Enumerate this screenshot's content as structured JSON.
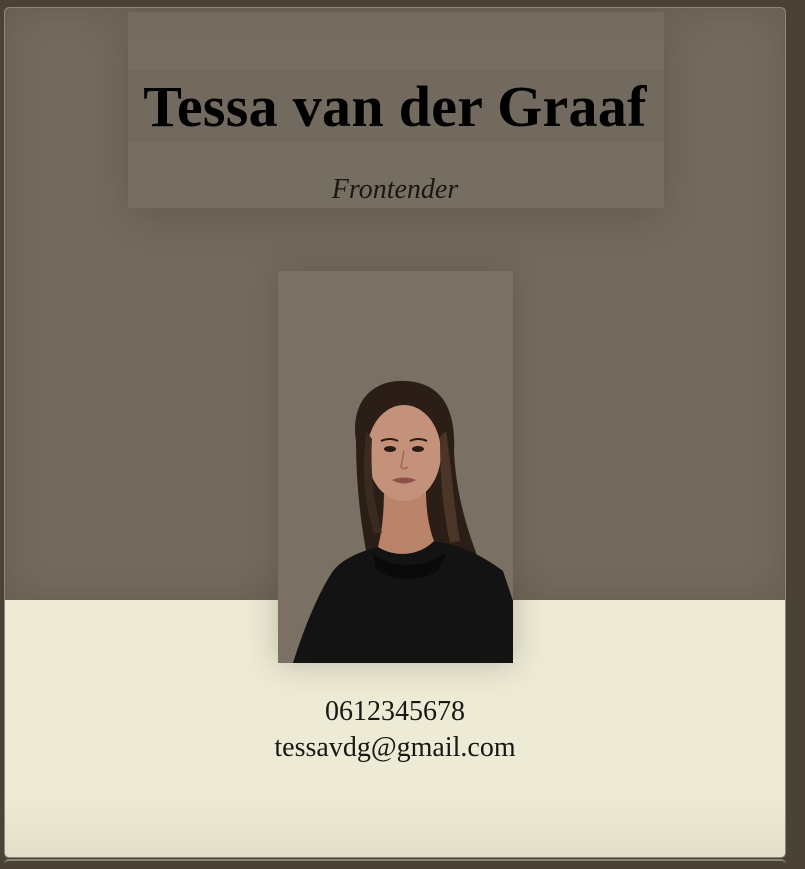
{
  "profile": {
    "name": "Tessa van der Graaf",
    "role": "Frontender",
    "phone": "0612345678",
    "email": "tessavdg@gmail.com"
  },
  "colors": {
    "page_background": "#4a4237",
    "top_panel": "#746a5e",
    "bottom_panel": "#edebd5",
    "heading_text": "#000000"
  },
  "icons": {
    "portrait": "profile-photo"
  }
}
